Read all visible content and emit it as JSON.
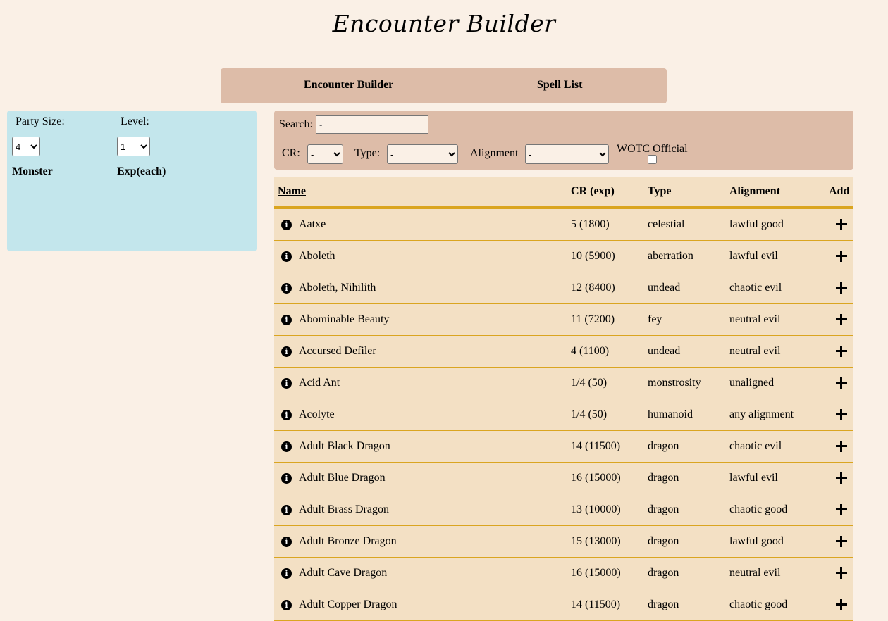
{
  "title": "Encounter Builder",
  "nav": {
    "items": [
      {
        "label": "Encounter Builder"
      },
      {
        "label": "Spell List"
      }
    ]
  },
  "party": {
    "size_label": "Party Size:",
    "size_value": "4",
    "level_label": "Level:",
    "level_value": "1",
    "monster_header": "Monster",
    "exp_header": "Exp(each)"
  },
  "filters": {
    "search_label": "Search:",
    "search_placeholder": "-",
    "cr_label": "CR:",
    "cr_value": "-",
    "type_label": "Type:",
    "type_value": "-",
    "alignment_label": "Alignment",
    "alignment_value": "-",
    "wotc_label": "WOTC Official",
    "wotc_checked": false
  },
  "table": {
    "headers": {
      "name": "Name",
      "cr": "CR (exp)",
      "type": "Type",
      "alignment": "Alignment",
      "add": "Add"
    },
    "rows": [
      {
        "name": "Aatxe",
        "cr": "5 (1800)",
        "type": "celestial",
        "alignment": "lawful good"
      },
      {
        "name": "Aboleth",
        "cr": "10 (5900)",
        "type": "aberration",
        "alignment": "lawful evil"
      },
      {
        "name": "Aboleth, Nihilith",
        "cr": "12 (8400)",
        "type": "undead",
        "alignment": "chaotic evil"
      },
      {
        "name": "Abominable Beauty",
        "cr": "11 (7200)",
        "type": "fey",
        "alignment": "neutral evil"
      },
      {
        "name": "Accursed Defiler",
        "cr": "4 (1100)",
        "type": "undead",
        "alignment": "neutral evil"
      },
      {
        "name": "Acid Ant",
        "cr": "1/4 (50)",
        "type": "monstrosity",
        "alignment": "unaligned"
      },
      {
        "name": "Acolyte",
        "cr": "1/4 (50)",
        "type": "humanoid",
        "alignment": "any alignment"
      },
      {
        "name": "Adult Black Dragon",
        "cr": "14 (11500)",
        "type": "dragon",
        "alignment": "chaotic evil"
      },
      {
        "name": "Adult Blue Dragon",
        "cr": "16 (15000)",
        "type": "dragon",
        "alignment": "lawful evil"
      },
      {
        "name": "Adult Brass Dragon",
        "cr": "13 (10000)",
        "type": "dragon",
        "alignment": "chaotic good"
      },
      {
        "name": "Adult Bronze Dragon",
        "cr": "15 (13000)",
        "type": "dragon",
        "alignment": "lawful good"
      },
      {
        "name": "Adult Cave Dragon",
        "cr": "16 (15000)",
        "type": "dragon",
        "alignment": "neutral evil"
      },
      {
        "name": "Adult Copper Dragon",
        "cr": "14 (11500)",
        "type": "dragon",
        "alignment": "chaotic good"
      }
    ]
  },
  "icons": {
    "info": "info-icon",
    "add": "plus-icon"
  },
  "colors": {
    "page_bg": "#faf0e6",
    "nav_bg": "#ddbca8",
    "party_bg": "#c3e6ec",
    "table_bg": "#f3e0c4",
    "table_border": "#daa520"
  }
}
